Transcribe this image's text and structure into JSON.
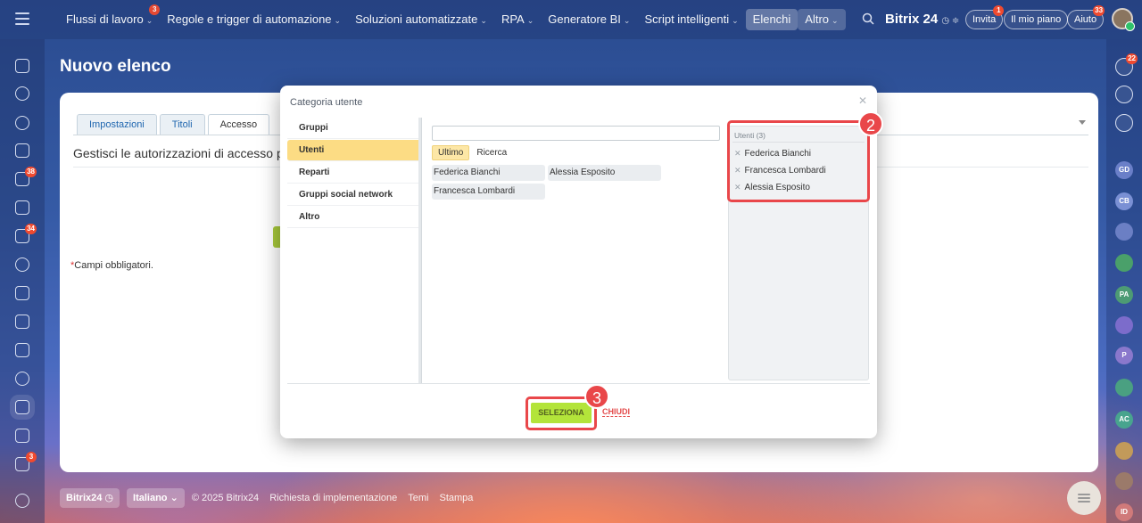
{
  "topbar": {
    "menu": [
      {
        "label": "Flussi di lavoro",
        "chevron": true,
        "badge": "3",
        "active": false
      },
      {
        "label": "Regole e trigger di automazione",
        "chevron": true,
        "badge": null,
        "active": false
      },
      {
        "label": "Soluzioni automatizzate",
        "chevron": true,
        "badge": null,
        "active": false
      },
      {
        "label": "RPA",
        "chevron": true,
        "badge": null,
        "active": false
      },
      {
        "label": "Generatore BI",
        "chevron": true,
        "badge": null,
        "active": false
      },
      {
        "label": "Script intelligenti",
        "chevron": true,
        "badge": null,
        "active": false
      },
      {
        "label": "Elenchi",
        "chevron": false,
        "badge": null,
        "active": true
      },
      {
        "label": "Altro",
        "chevron": true,
        "badge": null,
        "active": false
      }
    ],
    "brand": "Bitrix 24",
    "invite": {
      "label": "Invita",
      "badge": "1"
    },
    "plan": {
      "label": "Il mio piano"
    },
    "help": {
      "label": "Aiuto",
      "badge": "33"
    }
  },
  "leftbar": {
    "badges": {
      "tasks": "38",
      "feed": "34",
      "approvals": "3"
    }
  },
  "rightbar": {
    "notifications_badge": "22",
    "avatars": [
      "GD",
      "CB",
      "PA",
      "P",
      "AC",
      "ID"
    ]
  },
  "page": {
    "title": "Nuovo elenco",
    "tabs": [
      "Impostazioni",
      "Titoli",
      "Accesso"
    ],
    "active_tab": "Accesso",
    "description": "Gestisci le autorizzazioni di accesso pe",
    "required_note": "Campi obbligatori."
  },
  "footer": {
    "brand": "Bitrix24",
    "language": "Italiano",
    "copyright": "© 2025 Bitrix24",
    "links": [
      "Richiesta di implementazione",
      "Temi",
      "Stampa"
    ]
  },
  "dialog": {
    "title": "Categoria utente",
    "categories": [
      "Gruppi",
      "Utenti",
      "Reparti",
      "Gruppi social network",
      "Altro"
    ],
    "selected_category": "Utenti",
    "search_placeholder": "",
    "subtabs": [
      "Ultimo",
      "Ricerca"
    ],
    "users": [
      "Federica Bianchi",
      "Alessia Esposito",
      "Francesca Lombardi"
    ],
    "selected_header": "Utenti (3)",
    "selected": [
      "Federica Bianchi",
      "Francesca Lombardi",
      "Alessia Esposito"
    ],
    "select_button": "SELEZIONA",
    "close_button": "CHIUDI"
  },
  "annotations": {
    "step2": "2",
    "step3": "3"
  },
  "colors": {
    "accent_select": "#b3e43a",
    "highlight": "#e9474a",
    "category_selected": "#fcdc84"
  }
}
